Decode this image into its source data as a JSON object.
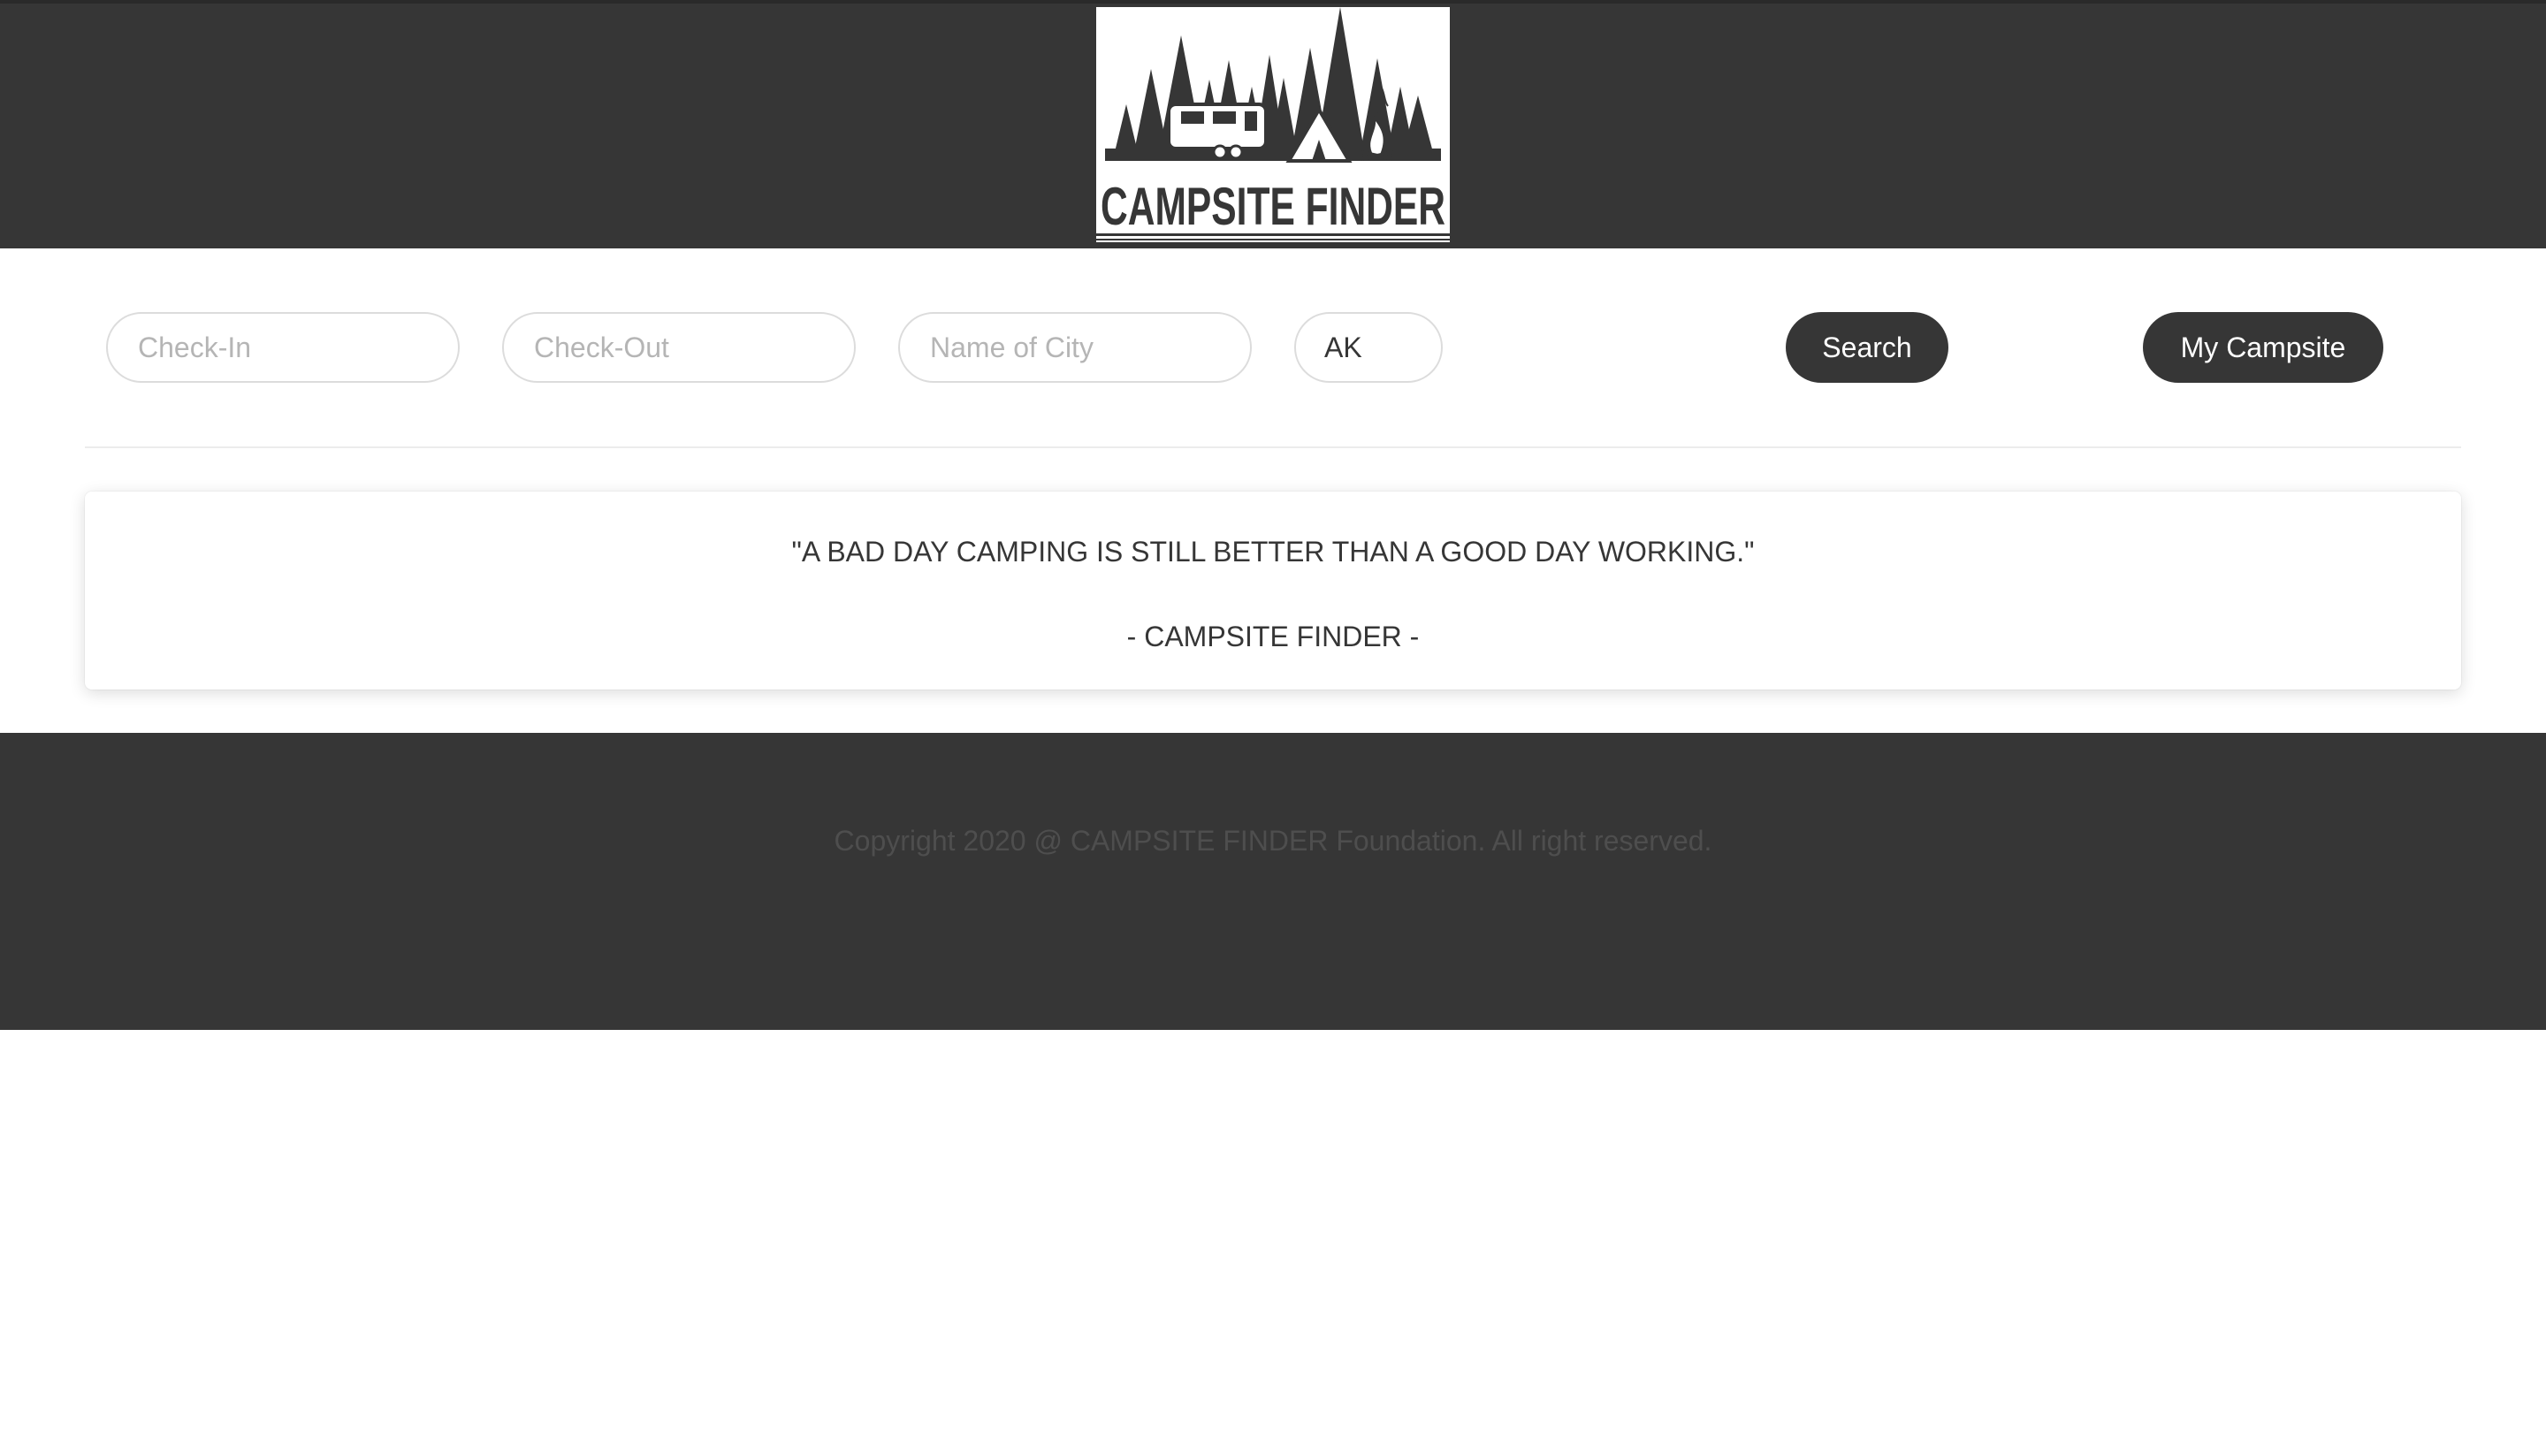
{
  "header": {
    "logo_text": "CAMPSITE FINDER"
  },
  "search": {
    "checkin_placeholder": "Check-In",
    "checkout_placeholder": "Check-Out",
    "city_placeholder": "Name of City",
    "state_value": "AK",
    "search_label": "Search",
    "my_campsite_label": "My Campsite"
  },
  "quote": {
    "text": "\"A BAD DAY CAMPING IS STILL BETTER THAN A GOOD DAY WORKING.\"",
    "signature": "- CAMPSITE FINDER -"
  },
  "footer": {
    "copyright": "Copyright 2020 @ CAMPSITE FINDER Foundation. All right reserved."
  },
  "colors": {
    "dark": "#363636",
    "background": "#ffffff",
    "muted_text": "#4e4e4e"
  }
}
